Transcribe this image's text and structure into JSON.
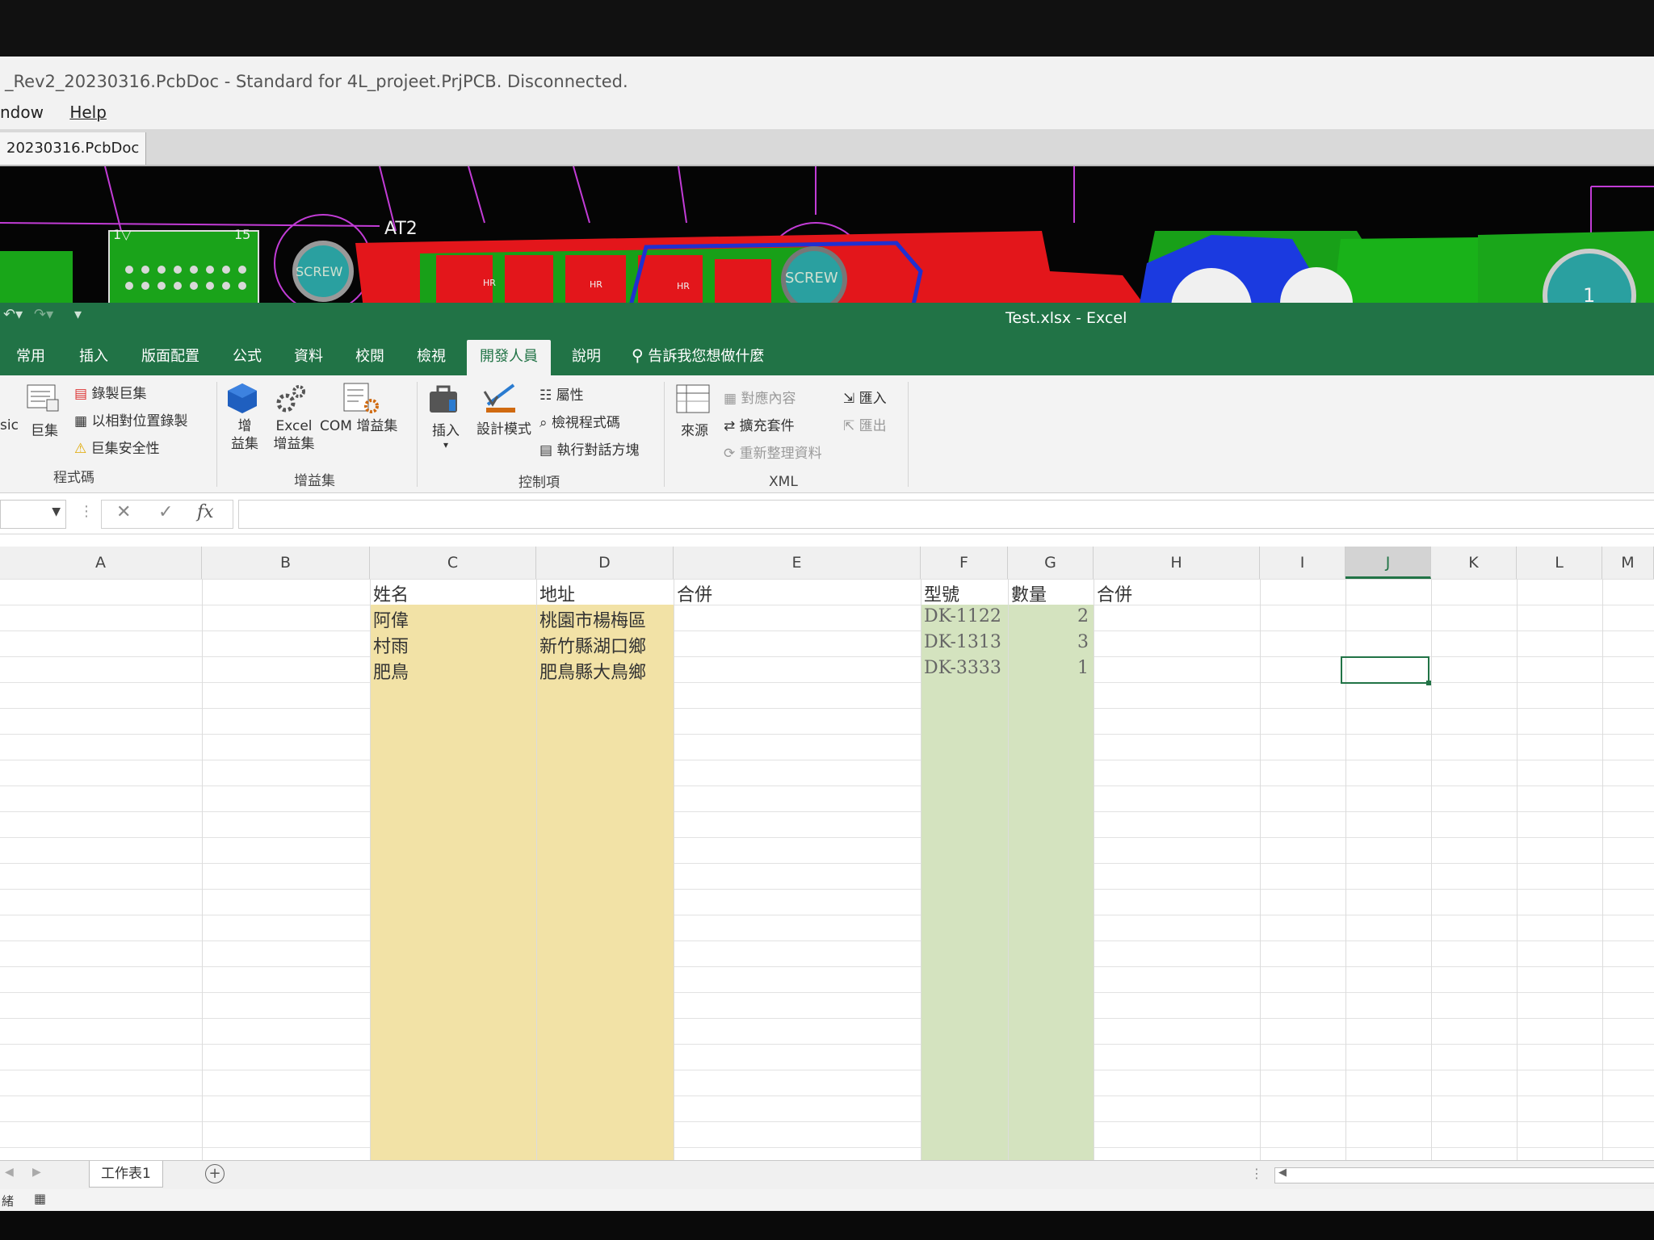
{
  "altium": {
    "title": "_Rev2_20230316.PcbDoc - Standard for 4L_projeet.PrjPCB. Disconnected.",
    "menu": [
      "ndow",
      "Help"
    ],
    "tab": "20230316.PcbDoc",
    "pcb_labels": {
      "pin1": "1▽",
      "pin15": "15",
      "ref": "AT2",
      "screw": "SCREW",
      "hr": "HR",
      "pad1": "1"
    }
  },
  "excel": {
    "title": "Test.xlsx  -  Excel",
    "tabs": [
      "常用",
      "插入",
      "版面配置",
      "公式",
      "資料",
      "校閱",
      "檢視",
      "開發人員",
      "說明"
    ],
    "active_tab": "開發人員",
    "tell_me": "告訴我您想做什麼",
    "ribbon": {
      "code": {
        "vba": "sic",
        "macros": "巨集",
        "record": "錄製巨集",
        "relative": "以相對位置錄製",
        "security": "巨集安全性",
        "group": "程式碼"
      },
      "addins": {
        "addins": "增\n益集",
        "excel_addins": "Excel\n增益集",
        "com_addins": "COM 增益集",
        "group": "增益集"
      },
      "controls": {
        "insert": "插入",
        "design_mode": "設計模式",
        "properties": "屬性",
        "view_code": "檢視程式碼",
        "run_dialog": "執行對話方塊",
        "group": "控制項"
      },
      "xml": {
        "source": "來源",
        "map_props": "對應內容",
        "expansion": "擴充套件",
        "refresh": "重新整理資料",
        "import": "匯入",
        "export": "匯出",
        "group": "XML"
      }
    },
    "columns": [
      "A",
      "B",
      "C",
      "D",
      "E",
      "F",
      "G",
      "H",
      "I",
      "J",
      "K",
      "L",
      "M"
    ],
    "selected_column": "J",
    "headers": {
      "c": "姓名",
      "d": "地址",
      "e": "合併",
      "f": "型號",
      "g": "數量",
      "h": "合併"
    },
    "rows": [
      {
        "name": "阿偉",
        "address": "桃園市楊梅區",
        "model": "DK-1122",
        "qty": "2"
      },
      {
        "name": "村雨",
        "address": "新竹縣湖口鄉",
        "model": "DK-1313",
        "qty": "3"
      },
      {
        "name": "肥鳥",
        "address": "肥鳥縣大鳥鄉",
        "model": "DK-3333",
        "qty": "1"
      }
    ],
    "sheet_tab": "工作表1",
    "add_sheet": "+",
    "status_ready": "緒",
    "colors": {
      "excel_green": "#217346",
      "yellow_fill": "#f2e2a6",
      "green_fill": "#d4e3bf"
    }
  }
}
